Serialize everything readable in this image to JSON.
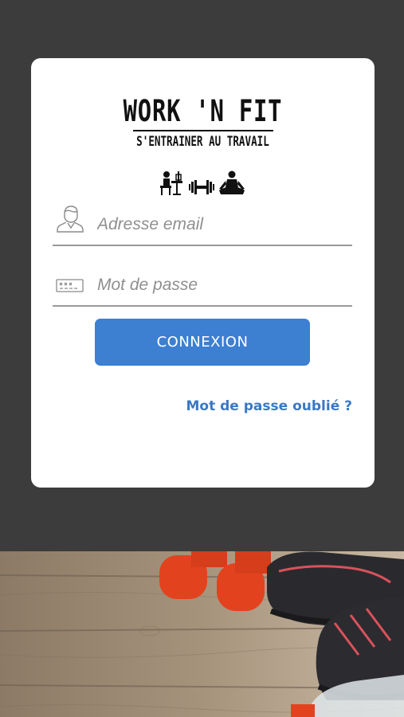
{
  "logo": {
    "title": "WORK 'N FIT",
    "subtitle": "S'ENTRAINER AU TRAVAIL",
    "icons": [
      "desk-worker-icon",
      "dumbbell-icon",
      "meditation-icon"
    ]
  },
  "login_form": {
    "email": {
      "placeholder": "Adresse email",
      "value": "",
      "icon": "user-icon"
    },
    "password": {
      "placeholder": "Mot de passe",
      "value": "",
      "icon": "password-icon"
    },
    "submit_label": "CONNEXION",
    "forgot_password_label": "Mot de passe oublié ?"
  },
  "colors": {
    "background": "#3c3c3c",
    "card": "#ffffff",
    "button": "#3d7fd1",
    "link": "#3a78c4",
    "dumbbell": "#e8401f"
  }
}
